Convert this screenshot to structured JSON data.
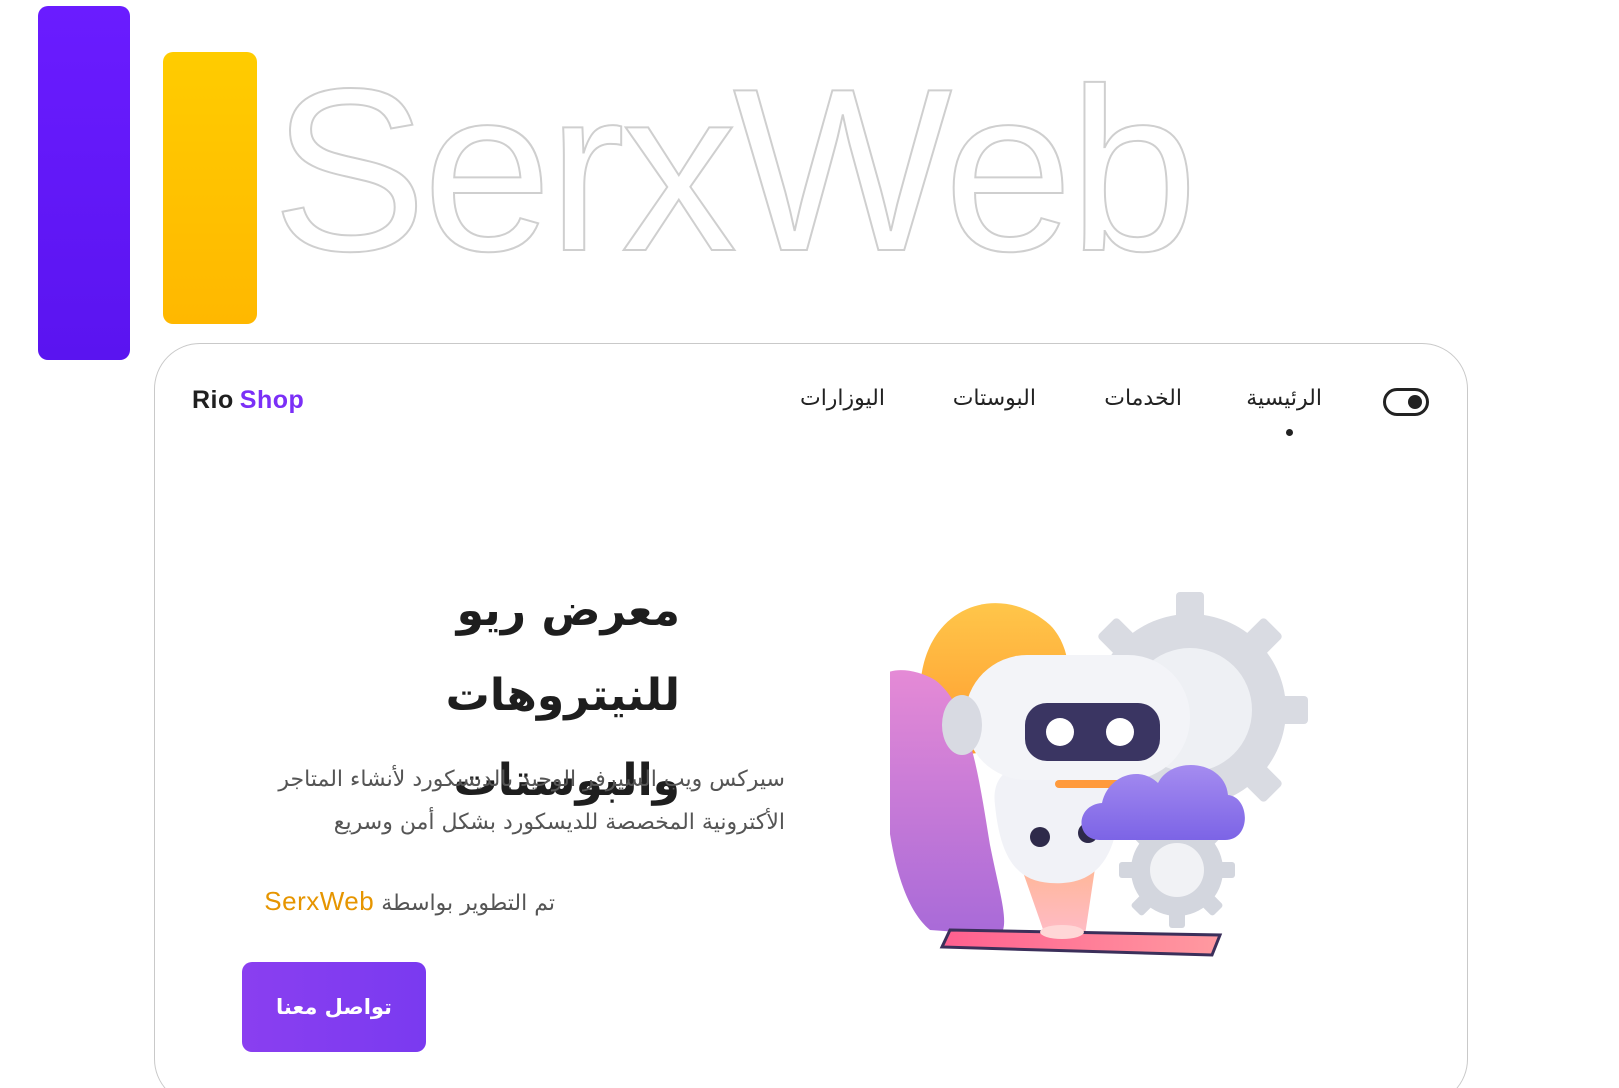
{
  "brand": {
    "wordmark": "SerxWeb",
    "colors": {
      "purple": "#6a1cff",
      "yellow": "#ffc400"
    }
  },
  "header": {
    "logo_part1": "Rio",
    "logo_part2": "Shop",
    "nav": {
      "home": "الرئيسية",
      "services": "الخدمات",
      "boosts": "البوستات",
      "users": "اليوزارات",
      "active": "home"
    },
    "toggle_icon": "toggle-icon"
  },
  "hero": {
    "title": "معرض ريو للنيتروهات والبوستات",
    "description": "سيركس ويب السيرفر الوحيد بالديسكورد لأنشاء المتاجر الأكترونية المخصصة للديسكورد بشكل أمن وسريع",
    "credit_text": "تم التطوير بواسطة",
    "credit_brand": "SerxWeb",
    "cta_label": "تواصل معنا",
    "illustration_icon": "robot-gears-cloud-illustration"
  },
  "colors": {
    "accent": "#7b2ff7",
    "credit": "#e69500",
    "text": "#1e1e1e"
  }
}
